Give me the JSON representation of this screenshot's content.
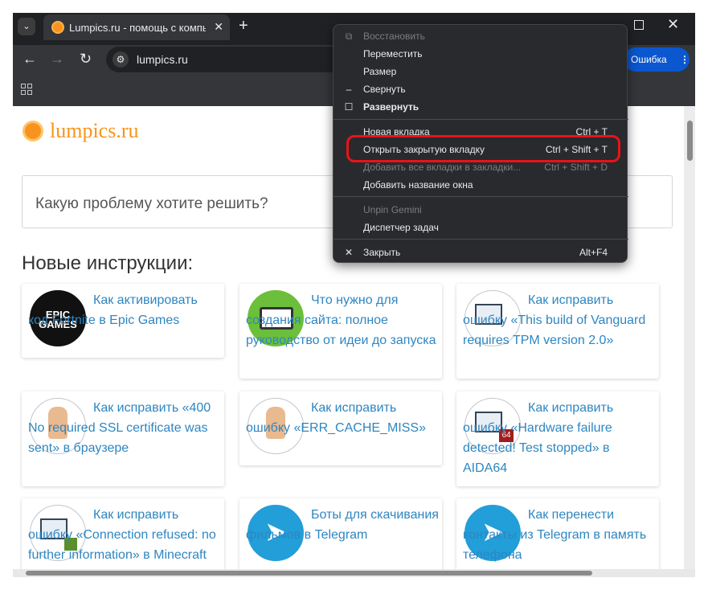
{
  "browser": {
    "tab_title": "Lumpics.ru - помощь с компьютером",
    "tab_close": "✕",
    "newtab_label": "+",
    "tab_menu_glyph": "⌄",
    "url": "lumpics.ru",
    "error_chip": "Ошибка",
    "window_close": "✕",
    "nav": {
      "back": "←",
      "forward": "→",
      "reload": "↻"
    }
  },
  "page": {
    "logo_text": "lumpics.ru",
    "search_placeholder": "Какую проблему хотите решить?",
    "section_title": "Новые инструкции:",
    "articles": [
      {
        "title": "Как активировать код Fortnite в Epic Games",
        "img_label": "EPIC GAMES"
      },
      {
        "title": "Что нужно для создания сайта: полное руководство от идеи до запуска",
        "img_label": ""
      },
      {
        "title": "Как исправить ошибку «This build of Vanguard requires TPM version 2.0»",
        "img_label": ""
      },
      {
        "title": "Как исправить «400 No required SSL certificate was sent» в браузере",
        "img_label": ""
      },
      {
        "title": "Как исправить ошибку «ERR_CACHE_MISS»",
        "img_label": ""
      },
      {
        "title": "Как исправить ошибку «Hardware failure detected! Test stopped» в AIDA64",
        "img_label": "64"
      },
      {
        "title": "Как исправить ошибку «Connection refused: no further information» в Minecraft",
        "img_label": ""
      },
      {
        "title": "Боты для скачивания фильмов в Telegram",
        "img_label": ""
      },
      {
        "title": "Как перенести контакты из Telegram в память телефона",
        "img_label": ""
      }
    ]
  },
  "context_menu": {
    "items": [
      {
        "label": "Восстановить",
        "shortcut": "",
        "icon": "⧉",
        "disabled": true
      },
      {
        "label": "Переместить",
        "shortcut": "",
        "icon": "",
        "disabled": false
      },
      {
        "label": "Размер",
        "shortcut": "",
        "icon": "",
        "disabled": false
      },
      {
        "label": "Свернуть",
        "shortcut": "",
        "icon": "–",
        "disabled": false
      },
      {
        "label": "Развернуть",
        "shortcut": "",
        "icon": "☐",
        "disabled": false
      },
      {
        "label": "Новая вкладка",
        "shortcut": "Ctrl + T",
        "icon": "",
        "disabled": false
      },
      {
        "label": "Открыть закрытую вкладку",
        "shortcut": "Ctrl + Shift + T",
        "icon": "",
        "disabled": false
      },
      {
        "label": "Добавить все вкладки в закладки...",
        "shortcut": "Ctrl + Shift + D",
        "icon": "",
        "disabled": true
      },
      {
        "label": "Добавить название окна",
        "shortcut": "",
        "icon": "",
        "disabled": false
      },
      {
        "label": "Unpin Gemini",
        "shortcut": "",
        "icon": "",
        "disabled": true
      },
      {
        "label": "Диспетчер задач",
        "shortcut": "",
        "icon": "",
        "disabled": false
      },
      {
        "label": "Закрыть",
        "shortcut": "Alt+F4",
        "icon": "✕",
        "disabled": false
      }
    ]
  },
  "colors": {
    "accent_orange": "#f7941d",
    "link_blue": "#2e86c1",
    "highlight_red": "#e8131a",
    "error_chip": "#0b57d0"
  }
}
